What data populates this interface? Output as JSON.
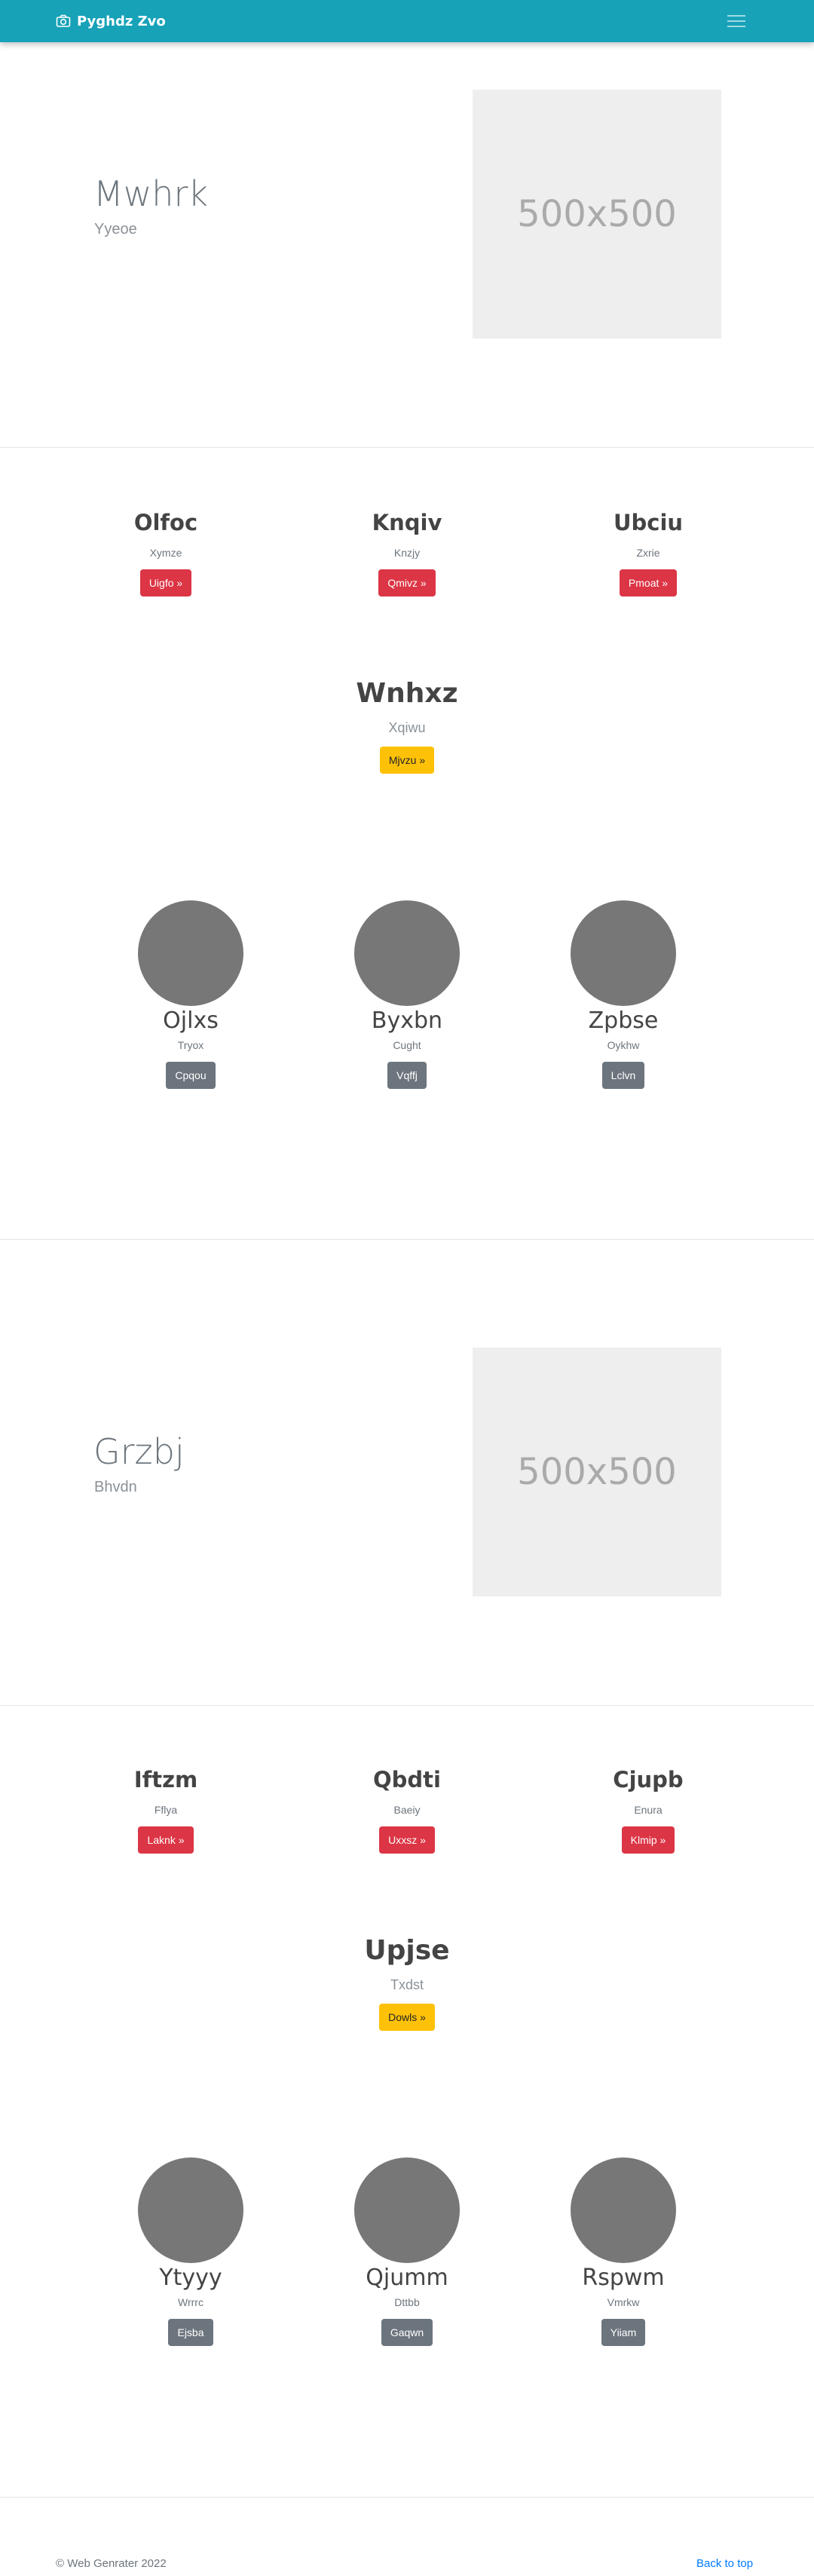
{
  "navbar": {
    "brand": "Pyghdz Zvo",
    "brand_icon": "camera-icon",
    "toggle_icon": "hamburger-menu-icon",
    "color": "#17a2b8"
  },
  "sections": [
    {
      "hero": {
        "title": "Mwhrk",
        "subtitle": "Yyeoe",
        "image_text": "500x500"
      },
      "columns": [
        {
          "title": "Olfoc",
          "text": "Xymze",
          "button": "Uigfo »"
        },
        {
          "title": "Knqiv",
          "text": "Knzjy",
          "button": "Qmivz »"
        },
        {
          "title": "Ubciu",
          "text": "Zxrie",
          "button": "Pmoat »"
        }
      ],
      "featured": {
        "title": "Wnhxz",
        "subtitle": "Xqiwu",
        "button": "Mjvzu »"
      },
      "people": [
        {
          "name": "Ojlxs",
          "role": "Tryox",
          "button": "Cpqou"
        },
        {
          "name": "Byxbn",
          "role": "Cught",
          "button": "Vqffj"
        },
        {
          "name": "Zpbse",
          "role": "Oykhw",
          "button": "Lclvn"
        }
      ]
    },
    {
      "hero": {
        "title": "Grzbj",
        "subtitle": "Bhvdn",
        "image_text": "500x500"
      },
      "columns": [
        {
          "title": "Iftzm",
          "text": "Fflya",
          "button": "Laknk »"
        },
        {
          "title": "Qbdti",
          "text": "Baeiy",
          "button": "Uxxsz »"
        },
        {
          "title": "Cjupb",
          "text": "Enura",
          "button": "Klmip »"
        }
      ],
      "featured": {
        "title": "Upjse",
        "subtitle": "Txdst",
        "button": "Dowls »"
      },
      "people": [
        {
          "name": "Ytyyy",
          "role": "Wrrrc",
          "button": "Ejsba"
        },
        {
          "name": "Qjumm",
          "role": "Dttbb",
          "button": "Gaqwn"
        },
        {
          "name": "Rspwm",
          "role": "Vmrkw",
          "button": "Yiiam"
        }
      ]
    }
  ],
  "footer": {
    "copyright": "© Web Genrater 2022",
    "back_to_top": "Back to top"
  }
}
